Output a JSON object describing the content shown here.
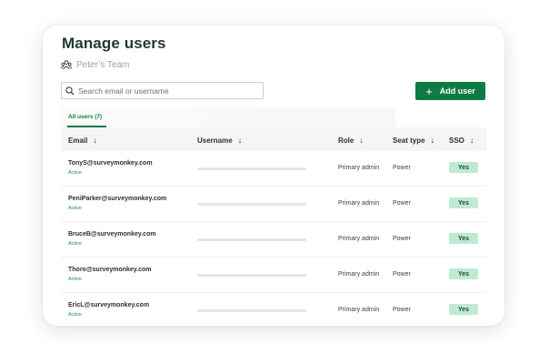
{
  "page": {
    "title": "Manage users",
    "team_name": "Peter’s Team"
  },
  "search": {
    "placeholder": "Search email or username"
  },
  "add_user": {
    "label": "Add user"
  },
  "tabs": [
    {
      "label": "All users (7)"
    }
  ],
  "table": {
    "headers": {
      "email": "Email",
      "username": "Username",
      "role": "Role",
      "seat_type": "Seat type",
      "sso": "SSO"
    },
    "rows": [
      {
        "email": "TonyS@surveymonkey.com",
        "status": "Active",
        "role": "Primary admin",
        "seat_type": "Power",
        "sso": "Yes"
      },
      {
        "email": "PeniParker@surveymonkey.com",
        "status": "Active",
        "role": "Primary admin",
        "seat_type": "Power",
        "sso": "Yes"
      },
      {
        "email": "BruceB@surveymonkey.com",
        "status": "Active",
        "role": "Primary admin",
        "seat_type": "Power",
        "sso": "Yes"
      },
      {
        "email": "Thoro@surveymonkey.com",
        "status": "Active",
        "role": "Primary admin",
        "seat_type": "Power",
        "sso": "Yes"
      },
      {
        "email": "EricL@surveymonkey.com",
        "status": "Active",
        "role": "Primary admin",
        "seat_type": "Power",
        "sso": "Yes"
      }
    ]
  },
  "colors": {
    "primary_green": "#0f7a43",
    "sso_badge_bg": "#bfe9d2",
    "active_text": "#1f8f57",
    "title_text": "#1f3a2f"
  },
  "icons": {
    "team": "team-icon",
    "search": "search-icon",
    "add": "plus-icon",
    "sort": "sort-arrow-down-icon"
  }
}
